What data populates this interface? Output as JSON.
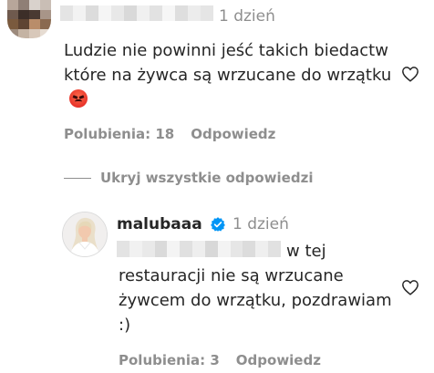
{
  "comment": {
    "time": "1 dzień",
    "text": "Ludzie nie powinni jeść takich biedactw które na żywca są wrzucane do wrzątku",
    "emoji": "angry-face",
    "likes_label": "Polubienia: 18",
    "reply_label": "Odpowiedz"
  },
  "hide_replies_label": "Ukryj wszystkie odpowiedzi",
  "reply": {
    "username": "malubaaa",
    "verified": true,
    "time": "1 dzień",
    "text_first": "w tej",
    "text_rest": "restauracji nie są wrzucane żywcem do wrzątku, pozdrawiam :)",
    "likes_label": "Polubienia: 3",
    "reply_label": "Odpowiedz"
  },
  "colors": {
    "text": "#262626",
    "secondary": "#8e8e8e",
    "verified": "#0095f6"
  }
}
